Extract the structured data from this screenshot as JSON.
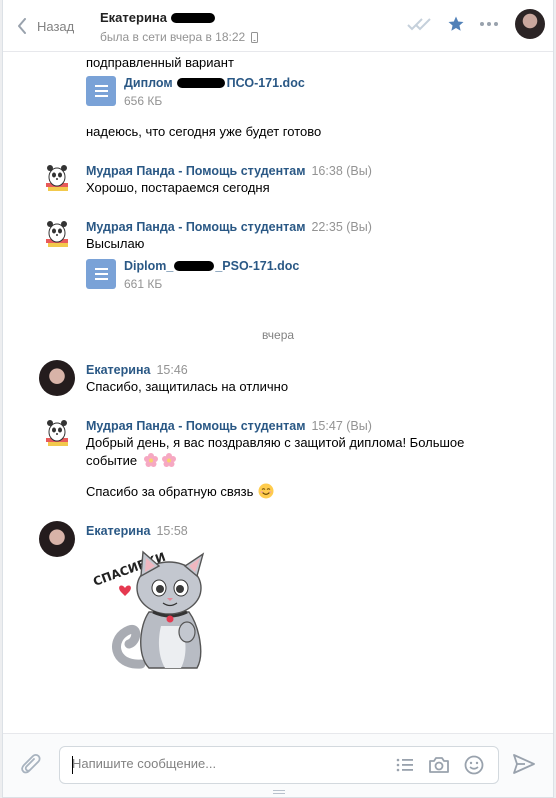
{
  "header": {
    "back_label": "Назад",
    "contact_name": "Екатерина",
    "status": "была в сети вчера в 18:22",
    "icons": [
      "checkmarks-icon",
      "star-icon",
      "more-icon"
    ]
  },
  "messages": [
    {
      "kind": "continuation",
      "text": "подправленный вариант"
    },
    {
      "kind": "document",
      "name_prefix": "Диплом",
      "name_suffix": "ПСО-171.doc",
      "size": "656 КБ"
    },
    {
      "kind": "continuation",
      "text": "надеюсь, что сегодня уже будет готово"
    },
    {
      "kind": "message",
      "author": "Мудрая Панда - Помощь студентам",
      "time": "16:38 (Вы)",
      "text": "Хорошо, постараемся сегодня"
    },
    {
      "kind": "message",
      "author": "Мудрая Панда - Помощь студентам",
      "time": "22:35 (Вы)",
      "text": "Высылаю"
    },
    {
      "kind": "document",
      "name_prefix": "Diplom_",
      "name_suffix": "_PSO-171.doc",
      "size": "661 КБ"
    },
    {
      "kind": "date",
      "text": "вчера"
    },
    {
      "kind": "message",
      "author": "Екатерина",
      "time": "15:46",
      "text": "Спасибо, защитилась на отлично"
    },
    {
      "kind": "message",
      "author": "Мудрая Панда - Помощь студентам",
      "time": "15:47 (Вы)",
      "text": "Добрый день, я вас поздравляю с защитой диплома! Большое событие"
    },
    {
      "kind": "continuation",
      "text": "Спасибо за обратную связь"
    },
    {
      "kind": "message",
      "author": "Екатерина",
      "time": "15:58",
      "text": ""
    },
    {
      "kind": "sticker",
      "text": "СПАСИБКИ"
    }
  ],
  "composer": {
    "placeholder": "Напишите сообщение..."
  },
  "colors": {
    "link": "#2a5885",
    "accent": "#5181b8",
    "doc_icon": "#7aa2d7",
    "meta": "#939393"
  }
}
